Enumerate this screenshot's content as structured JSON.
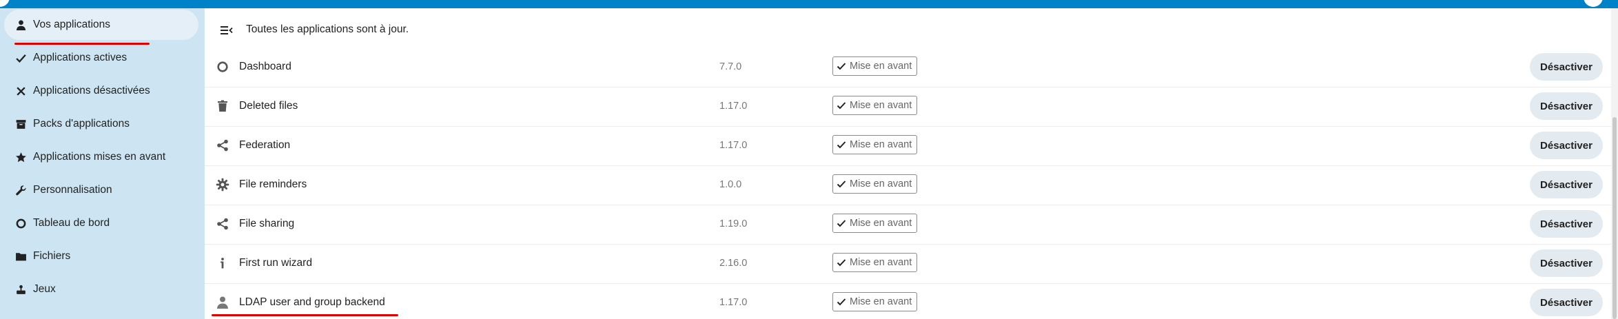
{
  "sidebar": {
    "items": [
      {
        "label": "Vos applications",
        "icon": "user-icon",
        "active": true
      },
      {
        "label": "Applications actives",
        "icon": "check-icon"
      },
      {
        "label": "Applications désactivées",
        "icon": "close-icon"
      },
      {
        "label": "Packs d'applications",
        "icon": "archive-icon"
      },
      {
        "label": "Applications mises en avant",
        "icon": "star-icon"
      },
      {
        "label": "Personnalisation",
        "icon": "wrench-icon"
      },
      {
        "label": "Tableau de bord",
        "icon": "circle-icon"
      },
      {
        "label": "Fichiers",
        "icon": "folder-icon"
      },
      {
        "label": "Jeux",
        "icon": "games-icon"
      }
    ]
  },
  "main": {
    "status": "Toutes les applications sont à jour.",
    "apps": [
      {
        "name": "Dashboard",
        "version": "7.7.0",
        "featured": "Mise en avant",
        "action": "Désactiver",
        "icon": "circle-icon"
      },
      {
        "name": "Deleted files",
        "version": "1.17.0",
        "featured": "Mise en avant",
        "action": "Désactiver",
        "icon": "trash-icon"
      },
      {
        "name": "Federation",
        "version": "1.17.0",
        "featured": "Mise en avant",
        "action": "Désactiver",
        "icon": "share-icon"
      },
      {
        "name": "File reminders",
        "version": "1.0.0",
        "featured": "Mise en avant",
        "action": "Désactiver",
        "icon": "gear-icon"
      },
      {
        "name": "File sharing",
        "version": "1.19.0",
        "featured": "Mise en avant",
        "action": "Désactiver",
        "icon": "share-icon"
      },
      {
        "name": "First run wizard",
        "version": "2.16.0",
        "featured": "Mise en avant",
        "action": "Désactiver",
        "icon": "info-icon"
      },
      {
        "name": "LDAP user and group backend",
        "version": "1.17.0",
        "featured": "Mise en avant",
        "action": "Désactiver",
        "icon": "user-icon"
      }
    ]
  },
  "colors": {
    "header_blue": "#0082c9",
    "sidebar_bg": "#cde4f2",
    "annotation_red": "#e00000",
    "button_bg": "#e4ebf0"
  }
}
